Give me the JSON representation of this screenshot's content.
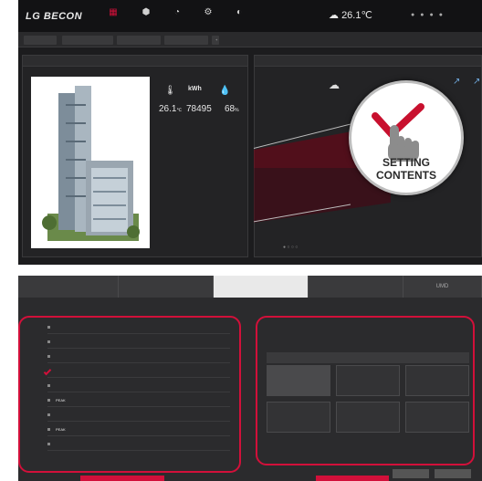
{
  "header": {
    "brand": "LG BECON",
    "nav": [
      "",
      "",
      "",
      "",
      ""
    ],
    "temperature": "26.1℃",
    "weather_sub": ""
  },
  "tabs": [
    "",
    "",
    "",
    ""
  ],
  "left_panel": {
    "title": "",
    "stats": [
      {
        "value": "26.1",
        "unit": "℃",
        "icon": "thermometer-icon"
      },
      {
        "value": "78495",
        "unit": "kWh",
        "icon": "energy-icon"
      },
      {
        "value": "68",
        "unit": "%",
        "icon": "humidity-icon"
      }
    ]
  },
  "callout": {
    "label_line1": "SETTING",
    "label_line2": "CONTENTS"
  },
  "bottom": {
    "tabs": [
      "",
      "",
      "",
      "",
      "UMD"
    ],
    "menu_items": [
      "",
      "",
      "",
      "",
      "",
      "PEAK",
      "",
      "PEAK",
      ""
    ],
    "checked_index": 3,
    "hint": "",
    "grid_header": "",
    "grid_cell_label": ""
  },
  "colors": {
    "accent": "#d2103a",
    "panel_bg": "#1c1c1e"
  }
}
